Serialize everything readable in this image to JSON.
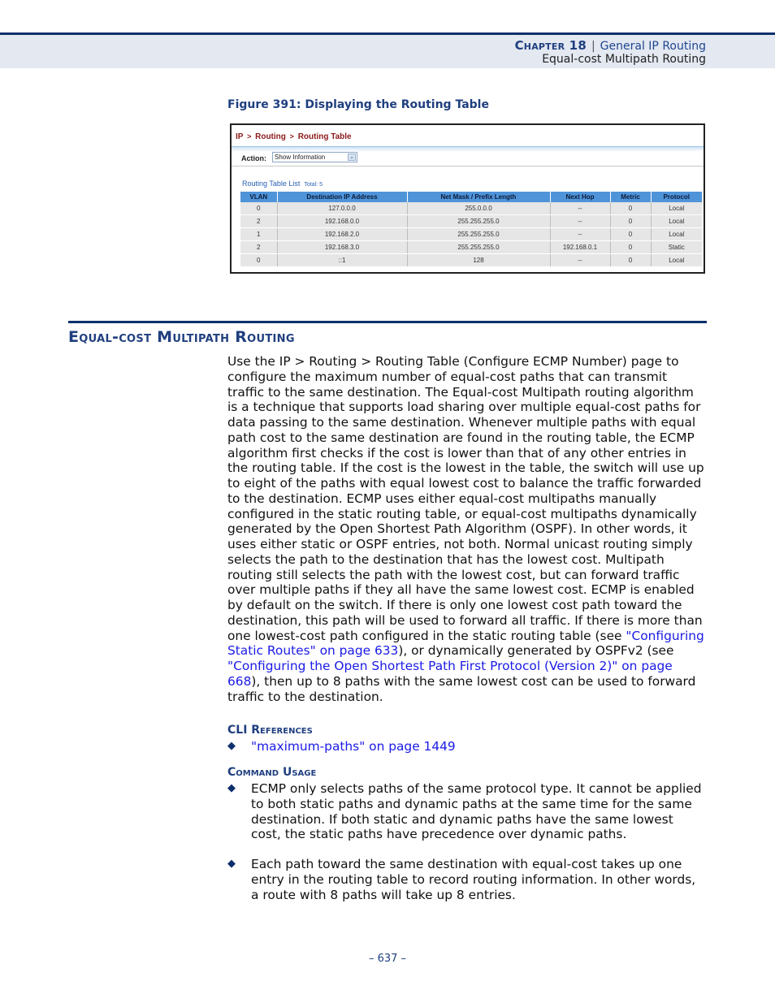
{
  "header": {
    "chapter_label": "Chapter 18",
    "separator": "|",
    "chapter_title": "General IP Routing",
    "section_title": "Equal-cost Multipath Routing"
  },
  "figure": {
    "caption": "Figure 391:  Displaying the Routing Table",
    "breadcrumb": [
      "IP",
      "Routing",
      "Routing Table"
    ],
    "breadcrumb_sep": ">",
    "action_label": "Action:",
    "action_value": "Show Information",
    "list_title": "Routing Table List",
    "total_label": "Total: 5",
    "columns": [
      "VLAN",
      "Destination IP Address",
      "Net Mask / Prefix Length",
      "Next Hop",
      "Metric",
      "Protocol"
    ],
    "rows": [
      [
        "0",
        "127.0.0.0",
        "255.0.0.0",
        "--",
        "0",
        "Local"
      ],
      [
        "2",
        "192.168.0.0",
        "255.255.255.0",
        "--",
        "0",
        "Local"
      ],
      [
        "1",
        "192.168.2.0",
        "255.255.255.0",
        "--",
        "0",
        "Local"
      ],
      [
        "2",
        "192.168.3.0",
        "255.255.255.0",
        "192.168.0.1",
        "0",
        "Static"
      ],
      [
        "0",
        "::1",
        "128",
        "--",
        "0",
        "Local"
      ]
    ]
  },
  "section": {
    "title": "Equal-cost Multipath Routing",
    "intro_before_link1": "Use the IP > Routing > Routing Table (Configure ECMP Number) page to configure the maximum number of equal-cost paths that can transmit traffic to the same destination. The Equal-cost Multipath routing algorithm is a technique that supports load sharing over multiple equal-cost paths for data passing to the same destination. Whenever multiple paths with equal path cost to the same destination are found in the routing table, the ECMP algorithm first checks if the cost is lower than that of any other entries in the routing table. If the cost is the lowest in the table, the switch will use up to eight of the paths with equal lowest cost to balance the traffic forwarded to the destination. ECMP uses either equal-cost multipaths manually configured in the static routing table, or equal-cost multipaths dynamically generated by the Open Shortest Path Algorithm (OSPF). In other words, it uses either static or OSPF entries, not both. Normal unicast routing simply selects the path to the destination that has the lowest cost. Multipath routing still selects the path with the lowest cost, but can forward traffic over multiple paths if they all have the same lowest cost. ECMP is enabled by default on the switch. If there is only one lowest cost path toward the destination, this path will be used to forward all traffic. If there is more than one lowest-cost path configured in the static routing table (see ",
    "link1": "\"Configuring Static Routes\" on page 633",
    "between_links": "), or dynamically generated by OSPFv2 (see ",
    "link2": "\"Configuring the Open Shortest Path First Protocol (Version 2)\" on page 668",
    "after_link2": "), then up to 8 paths with the same lowest cost can be used to forward traffic to the destination."
  },
  "cli_references": {
    "heading": "CLI References",
    "items": [
      "\"maximum-paths\" on page 1449"
    ]
  },
  "command_usage": {
    "heading": "Command Usage",
    "items": [
      "ECMP only selects paths of the same protocol type. It cannot be applied to both static paths and dynamic paths at the same time for the same destination. If both static and dynamic paths have the same lowest cost, the static paths have precedence over dynamic paths.",
      "Each path toward the same destination with equal-cost takes up one entry in the routing table to record routing information. In other words, a route with 8 paths will take up 8 entries."
    ]
  },
  "footer": {
    "page_number": "–  637  –"
  }
}
